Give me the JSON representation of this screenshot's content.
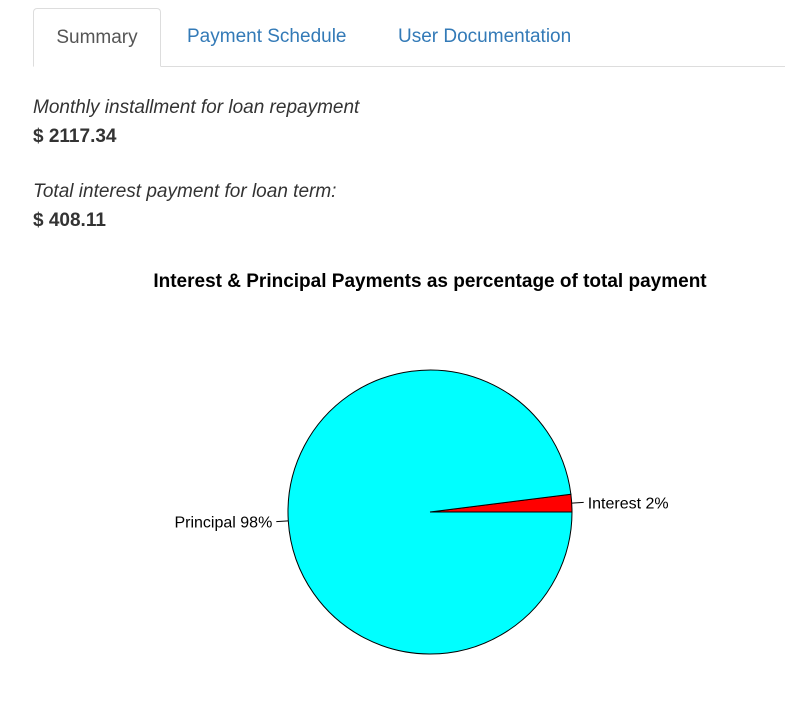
{
  "tabs": [
    {
      "label": "Summary",
      "active": true
    },
    {
      "label": "Payment Schedule",
      "active": false
    },
    {
      "label": "User Documentation",
      "active": false
    }
  ],
  "summary": {
    "installment_label": "Monthly installment for loan repayment",
    "installment_value": "$ 2117.34",
    "interest_label": "Total interest payment for loan term:",
    "interest_value": "$ 408.11"
  },
  "colors": {
    "link": "#337ab7",
    "principal": "#00ffff",
    "interest": "#ff0000"
  },
  "chart_data": {
    "type": "pie",
    "title": "Interest & Principal Payments as percentage of total payment",
    "slices": [
      {
        "label": "Interest 2%",
        "value": 2,
        "color": "#ff0000"
      },
      {
        "label": "Principal 98%",
        "value": 98,
        "color": "#00ffff"
      }
    ]
  }
}
